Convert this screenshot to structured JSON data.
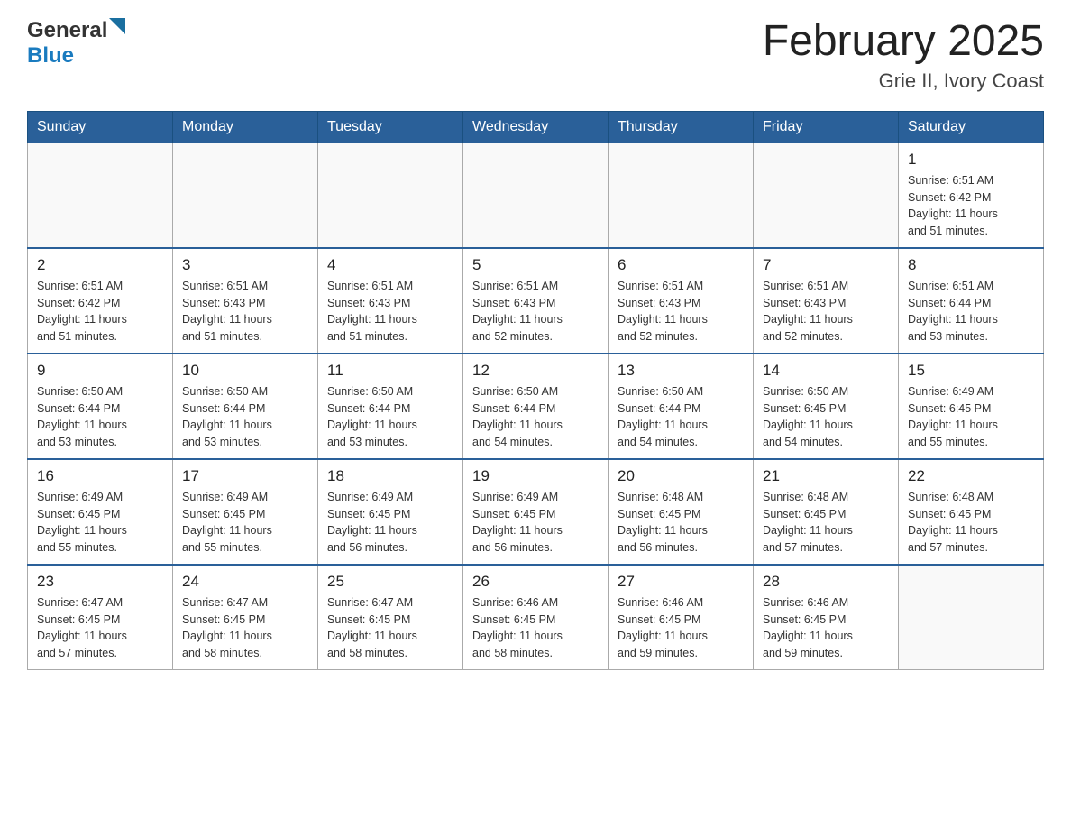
{
  "header": {
    "logo_general": "General",
    "logo_blue": "Blue",
    "month_year": "February 2025",
    "location": "Grie II, Ivory Coast"
  },
  "weekdays": [
    "Sunday",
    "Monday",
    "Tuesday",
    "Wednesday",
    "Thursday",
    "Friday",
    "Saturday"
  ],
  "weeks": [
    [
      {
        "day": "",
        "info": ""
      },
      {
        "day": "",
        "info": ""
      },
      {
        "day": "",
        "info": ""
      },
      {
        "day": "",
        "info": ""
      },
      {
        "day": "",
        "info": ""
      },
      {
        "day": "",
        "info": ""
      },
      {
        "day": "1",
        "info": "Sunrise: 6:51 AM\nSunset: 6:42 PM\nDaylight: 11 hours\nand 51 minutes."
      }
    ],
    [
      {
        "day": "2",
        "info": "Sunrise: 6:51 AM\nSunset: 6:42 PM\nDaylight: 11 hours\nand 51 minutes."
      },
      {
        "day": "3",
        "info": "Sunrise: 6:51 AM\nSunset: 6:43 PM\nDaylight: 11 hours\nand 51 minutes."
      },
      {
        "day": "4",
        "info": "Sunrise: 6:51 AM\nSunset: 6:43 PM\nDaylight: 11 hours\nand 51 minutes."
      },
      {
        "day": "5",
        "info": "Sunrise: 6:51 AM\nSunset: 6:43 PM\nDaylight: 11 hours\nand 52 minutes."
      },
      {
        "day": "6",
        "info": "Sunrise: 6:51 AM\nSunset: 6:43 PM\nDaylight: 11 hours\nand 52 minutes."
      },
      {
        "day": "7",
        "info": "Sunrise: 6:51 AM\nSunset: 6:43 PM\nDaylight: 11 hours\nand 52 minutes."
      },
      {
        "day": "8",
        "info": "Sunrise: 6:51 AM\nSunset: 6:44 PM\nDaylight: 11 hours\nand 53 minutes."
      }
    ],
    [
      {
        "day": "9",
        "info": "Sunrise: 6:50 AM\nSunset: 6:44 PM\nDaylight: 11 hours\nand 53 minutes."
      },
      {
        "day": "10",
        "info": "Sunrise: 6:50 AM\nSunset: 6:44 PM\nDaylight: 11 hours\nand 53 minutes."
      },
      {
        "day": "11",
        "info": "Sunrise: 6:50 AM\nSunset: 6:44 PM\nDaylight: 11 hours\nand 53 minutes."
      },
      {
        "day": "12",
        "info": "Sunrise: 6:50 AM\nSunset: 6:44 PM\nDaylight: 11 hours\nand 54 minutes."
      },
      {
        "day": "13",
        "info": "Sunrise: 6:50 AM\nSunset: 6:44 PM\nDaylight: 11 hours\nand 54 minutes."
      },
      {
        "day": "14",
        "info": "Sunrise: 6:50 AM\nSunset: 6:45 PM\nDaylight: 11 hours\nand 54 minutes."
      },
      {
        "day": "15",
        "info": "Sunrise: 6:49 AM\nSunset: 6:45 PM\nDaylight: 11 hours\nand 55 minutes."
      }
    ],
    [
      {
        "day": "16",
        "info": "Sunrise: 6:49 AM\nSunset: 6:45 PM\nDaylight: 11 hours\nand 55 minutes."
      },
      {
        "day": "17",
        "info": "Sunrise: 6:49 AM\nSunset: 6:45 PM\nDaylight: 11 hours\nand 55 minutes."
      },
      {
        "day": "18",
        "info": "Sunrise: 6:49 AM\nSunset: 6:45 PM\nDaylight: 11 hours\nand 56 minutes."
      },
      {
        "day": "19",
        "info": "Sunrise: 6:49 AM\nSunset: 6:45 PM\nDaylight: 11 hours\nand 56 minutes."
      },
      {
        "day": "20",
        "info": "Sunrise: 6:48 AM\nSunset: 6:45 PM\nDaylight: 11 hours\nand 56 minutes."
      },
      {
        "day": "21",
        "info": "Sunrise: 6:48 AM\nSunset: 6:45 PM\nDaylight: 11 hours\nand 57 minutes."
      },
      {
        "day": "22",
        "info": "Sunrise: 6:48 AM\nSunset: 6:45 PM\nDaylight: 11 hours\nand 57 minutes."
      }
    ],
    [
      {
        "day": "23",
        "info": "Sunrise: 6:47 AM\nSunset: 6:45 PM\nDaylight: 11 hours\nand 57 minutes."
      },
      {
        "day": "24",
        "info": "Sunrise: 6:47 AM\nSunset: 6:45 PM\nDaylight: 11 hours\nand 58 minutes."
      },
      {
        "day": "25",
        "info": "Sunrise: 6:47 AM\nSunset: 6:45 PM\nDaylight: 11 hours\nand 58 minutes."
      },
      {
        "day": "26",
        "info": "Sunrise: 6:46 AM\nSunset: 6:45 PM\nDaylight: 11 hours\nand 58 minutes."
      },
      {
        "day": "27",
        "info": "Sunrise: 6:46 AM\nSunset: 6:45 PM\nDaylight: 11 hours\nand 59 minutes."
      },
      {
        "day": "28",
        "info": "Sunrise: 6:46 AM\nSunset: 6:45 PM\nDaylight: 11 hours\nand 59 minutes."
      },
      {
        "day": "",
        "info": ""
      }
    ]
  ]
}
